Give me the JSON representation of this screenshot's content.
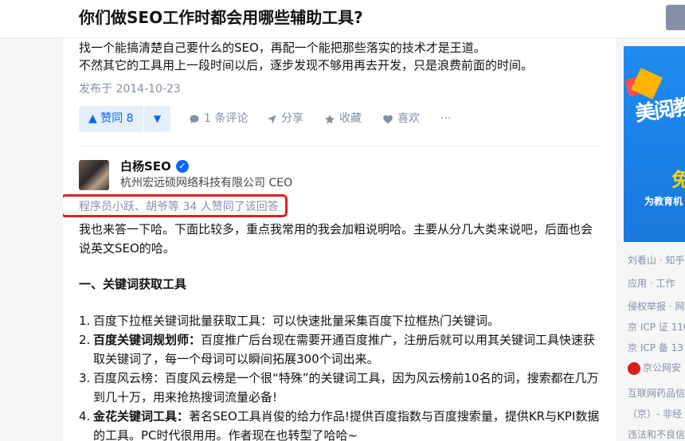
{
  "question": {
    "title": "你们做SEO工作时都会用哪些辅助工具?"
  },
  "prev_answer": {
    "line1": "找一个能搞清楚自己要什么的SEO，再配一个能把那些落实的技术才是王道。",
    "line2": "不然其它的工具用上一段时间以后，逐步发现不够用再去开发，只是浪费前面的时间。",
    "published": "发布于 2014-10-23",
    "actions": {
      "upvote": "▲ 赞同 8",
      "downvote": "▼",
      "comment": "1 条评论",
      "share": "分享",
      "collect": "收藏",
      "like": "喜欢",
      "more": "···"
    }
  },
  "answer": {
    "author_name": "白杨SEO",
    "author_headline": "杭州宏远硕网络科技有限公司 CEO",
    "voters": "程序员小跃、胡爷等 34 人赞同了该回答",
    "intro1": "我也来答一下哈。下面比较多，重点我常用的我会加粗说明哈。主要从分几大类来说吧，后面也会",
    "intro2": "说英文SEO的哈。",
    "section1": "一、关键词获取工具",
    "items": [
      {
        "num": "1.",
        "bold": "",
        "text": "百度下拉框关键词批量获取工具：可以快速批量采集百度下拉框热门关键词。",
        "cont": ""
      },
      {
        "num": "2.",
        "bold": "百度关键词规划师：",
        "text": "百度推广后台现在需要开通百度推广，注册后就可以用其关键词工具快速获",
        "cont": "取关键词了，每一个母词可以瞬间拓展300个词出来。"
      },
      {
        "num": "3.",
        "bold": "",
        "text": "百度风云榜：百度风云榜是一个很“特殊”的关键词工具，因为风云榜前10名的词，搜索都在几万",
        "cont": "到几十万，用来抢热搜词流量必备!"
      },
      {
        "num": "4.",
        "bold": "金花关键词工具：",
        "text": "著名SEO工具肖俊的给力作品!提供百度指数与百度搜索量，提供KR与KPI数据",
        "cont": "的工具。PC时代很用用。作者现在也转型了哈哈~"
      }
    ]
  },
  "sidebar": {
    "banner_big": "美阅教",
    "banner_yellow": "免",
    "banner_sub": "为教育机",
    "links": [
      "刘看山 · 知乎",
      "应用 · 工作",
      "侵权举报 · 网",
      "京 ICP 证 110",
      "京 ICP 备 13",
      "京公网安",
      "互联网药品信",
      "（京）- 非经",
      "违法和不良信"
    ]
  }
}
